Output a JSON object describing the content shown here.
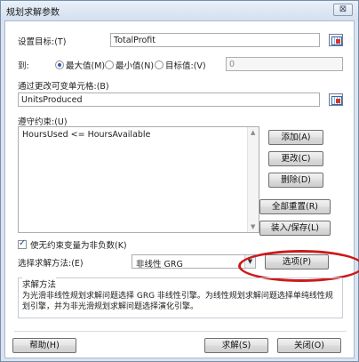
{
  "window": {
    "title": "规划求解参数",
    "close_glyph": "⊠"
  },
  "objective": {
    "label": "设置目标:(T)",
    "value": "TotalProfit"
  },
  "to": {
    "label": "到:",
    "options": [
      {
        "label": "最大值(M)",
        "selected": true
      },
      {
        "label": "最小值(N)",
        "selected": false
      },
      {
        "label": "目标值:(V)",
        "selected": false
      }
    ],
    "target_value": "0"
  },
  "variables": {
    "label": "通过更改可变单元格:(B)",
    "value": "UnitsProduced"
  },
  "constraints": {
    "label": "遵守约束:(U)",
    "items": [
      "HoursUsed <= HoursAvailable"
    ],
    "buttons": {
      "add": "添加(A)",
      "change": "更改(C)",
      "delete": "删除(D)",
      "reset_all": "全部重置(R)",
      "load_save": "装入/保存(L)"
    }
  },
  "nonnegative": {
    "label": "使无约束变量为非负数(K)",
    "checked": true
  },
  "method": {
    "label": "选择求解方法:(E)",
    "value": "非线性 GRG",
    "options_button": "选项(P)"
  },
  "method_group": {
    "title": "求解方法",
    "description": "为光滑非线性规划求解问题选择 GRG 非线性引擎。为线性规划求解问题选择单纯线性规划引擎，并为非光滑规划求解问题选择演化引擎。"
  },
  "footer": {
    "help": "帮助(H)",
    "solve": "求解(S)",
    "close": "关闭(O)"
  },
  "colors": {
    "highlight": "#cc1a1a",
    "panel_bg": "#ffffff",
    "window_bg": "#d9e4f1"
  }
}
